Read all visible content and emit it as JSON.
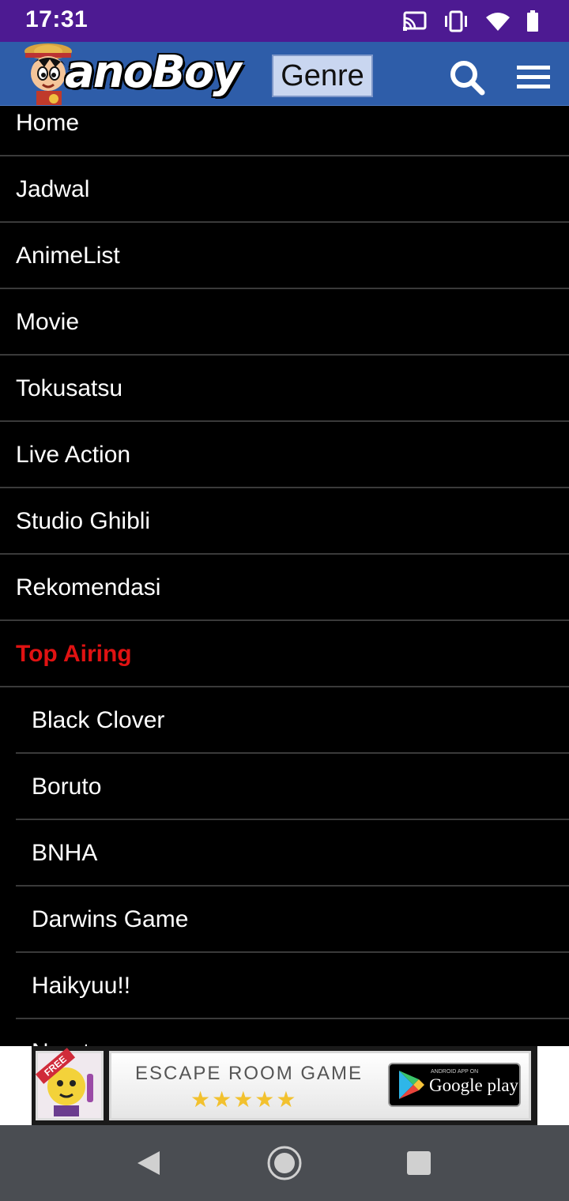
{
  "status_bar": {
    "time": "17:31",
    "icons": [
      "cast-icon",
      "vibrate-icon",
      "wifi-icon",
      "battery-icon"
    ]
  },
  "header": {
    "logo_text": "anoBoy",
    "genre_label": "Genre",
    "icons": [
      "search-icon",
      "menu-icon"
    ]
  },
  "menu": {
    "items": [
      {
        "label": "Home",
        "type": "main"
      },
      {
        "label": "Jadwal",
        "type": "main"
      },
      {
        "label": "AnimeList",
        "type": "main"
      },
      {
        "label": "Movie",
        "type": "main"
      },
      {
        "label": "Tokusatsu",
        "type": "main"
      },
      {
        "label": "Live Action",
        "type": "main"
      },
      {
        "label": "Studio Ghibli",
        "type": "main"
      },
      {
        "label": "Rekomendasi",
        "type": "main"
      },
      {
        "label": "Top Airing",
        "type": "highlight"
      },
      {
        "label": "Black Clover",
        "type": "sub"
      },
      {
        "label": "Boruto",
        "type": "sub"
      },
      {
        "label": "BNHA",
        "type": "sub"
      },
      {
        "label": "Darwins Game",
        "type": "sub"
      },
      {
        "label": "Haikyuu!!",
        "type": "sub"
      },
      {
        "label": "Naruto",
        "type": "sub"
      }
    ]
  },
  "ad": {
    "badge": "FREE",
    "title": "ESCAPE ROOM GAME",
    "stars": "★★★★★",
    "store_small": "ANDROID APP ON",
    "store_label": "Google play"
  },
  "colors": {
    "status_bar": "#4d1a92",
    "header": "#2e5da9",
    "highlight": "#e01212",
    "nav_bar": "#4a4d52"
  }
}
